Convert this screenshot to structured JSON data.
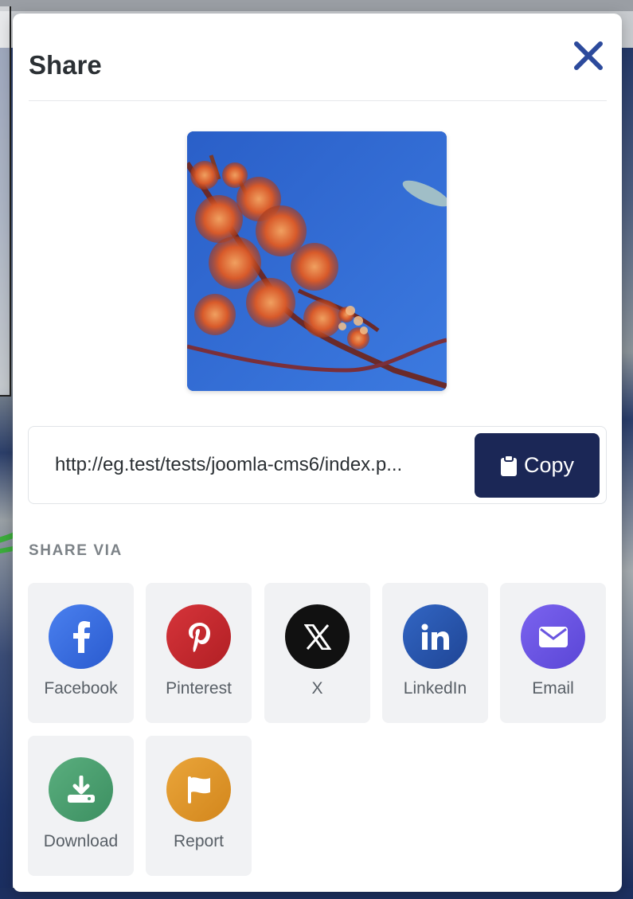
{
  "modal": {
    "title": "Share",
    "close_icon": "close-icon"
  },
  "preview": {
    "icon": "flower-photo"
  },
  "share_link": {
    "url_value": "http://eg.test/tests/joomla-cms6/index.p...",
    "copy_label": "Copy",
    "copy_icon": "clipboard-icon"
  },
  "share_via": {
    "heading": "SHARE VIA",
    "options": [
      {
        "label": "Facebook",
        "icon": "facebook-icon",
        "color": "#3b6fe0"
      },
      {
        "label": "Pinterest",
        "icon": "pinterest-icon",
        "color": "#c5282b"
      },
      {
        "label": "X",
        "icon": "x-icon",
        "color": "#111111"
      },
      {
        "label": "LinkedIn",
        "icon": "linkedin-icon",
        "color": "#2856b0"
      },
      {
        "label": "Email",
        "icon": "email-icon",
        "color": "#6a56e0"
      },
      {
        "label": "Download",
        "icon": "download-icon",
        "color": "#4aa071"
      },
      {
        "label": "Report",
        "icon": "flag-icon",
        "color": "#e0962a"
      }
    ]
  },
  "colors": {
    "copy_button": "#1b2756",
    "close_icon": "#2c4a9c",
    "tile_background": "#f1f2f4"
  }
}
